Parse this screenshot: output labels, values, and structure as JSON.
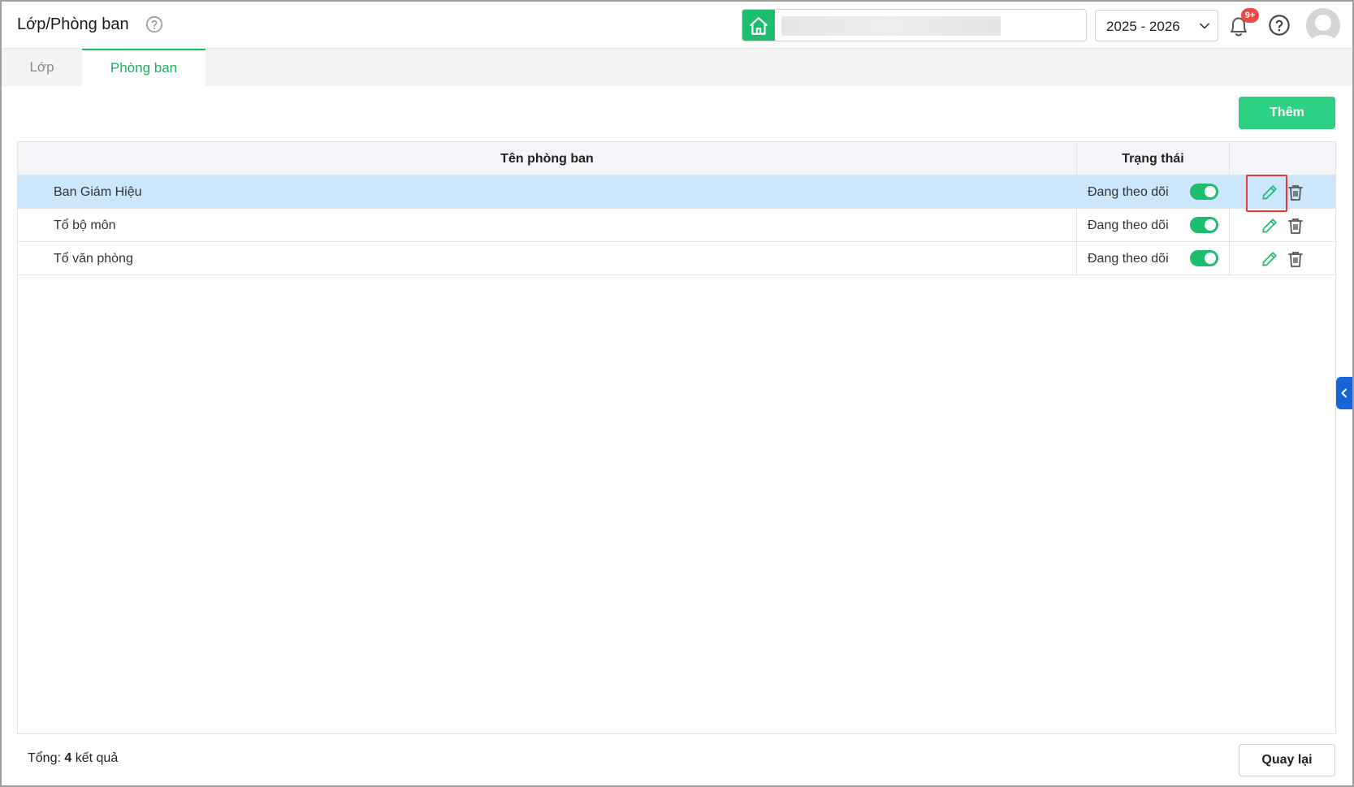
{
  "header": {
    "title": "Lớp/Phòng ban",
    "school_name": "",
    "year_selected": "2025 - 2026",
    "notification_badge": "9+"
  },
  "tabs": [
    {
      "label": "Lớp",
      "active": false
    },
    {
      "label": "Phòng ban",
      "active": true
    }
  ],
  "toolbar": {
    "add_label": "Thêm"
  },
  "table": {
    "columns": [
      "Tên phòng ban",
      "Trạng thái",
      ""
    ],
    "rows": [
      {
        "name": "Ban Giám Hiệu",
        "status": "Đang theo dõi",
        "enabled": true,
        "selected": true
      },
      {
        "name": "Tổ bộ môn",
        "status": "Đang theo dõi",
        "enabled": true,
        "selected": false
      },
      {
        "name": "Tổ văn phòng",
        "status": "Đang theo dõi",
        "enabled": true,
        "selected": false
      }
    ]
  },
  "footer": {
    "total_prefix": "Tổng:",
    "total_count": "4",
    "total_suffix": "kết quả",
    "back_label": "Quay lại"
  },
  "colors": {
    "accent_green": "#1cbd6d",
    "button_green": "#2dd183",
    "selected_row": "#cce6fb",
    "badge_red": "#f04747",
    "side_tab_blue": "#1565d8"
  }
}
